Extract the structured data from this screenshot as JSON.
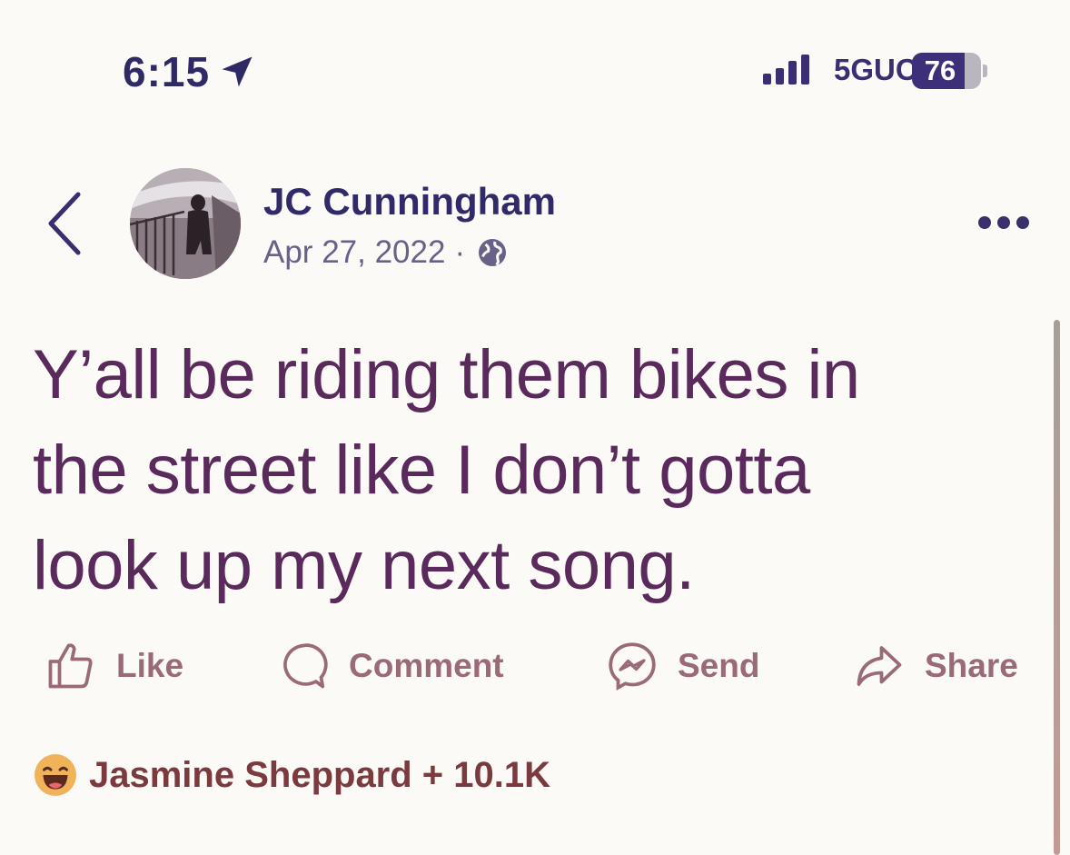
{
  "status_bar": {
    "time": "6:15",
    "network": "5GUC",
    "battery": "76",
    "battery_level": 0.76
  },
  "header": {
    "author": "JC Cunningham",
    "date": "Apr 27, 2022",
    "separator": "·",
    "privacy_icon": "globe-icon"
  },
  "post": {
    "lines": [
      "Y’all be riding them bikes in",
      "the street like I don’t gotta",
      "look up my next song."
    ]
  },
  "actions": {
    "like": "Like",
    "comment": "Comment",
    "send": "Send",
    "share": "Share"
  },
  "reactions": {
    "text": "Jasmine Sheppard + 10.1K",
    "emoji": "laughing-face-icon"
  },
  "colors": {
    "background": "#fbfaf6",
    "header_text": "#302a6a",
    "post_text": "#5a2a5c",
    "action_text": "#9a6a78",
    "reaction_text": "#7a3a3e"
  }
}
